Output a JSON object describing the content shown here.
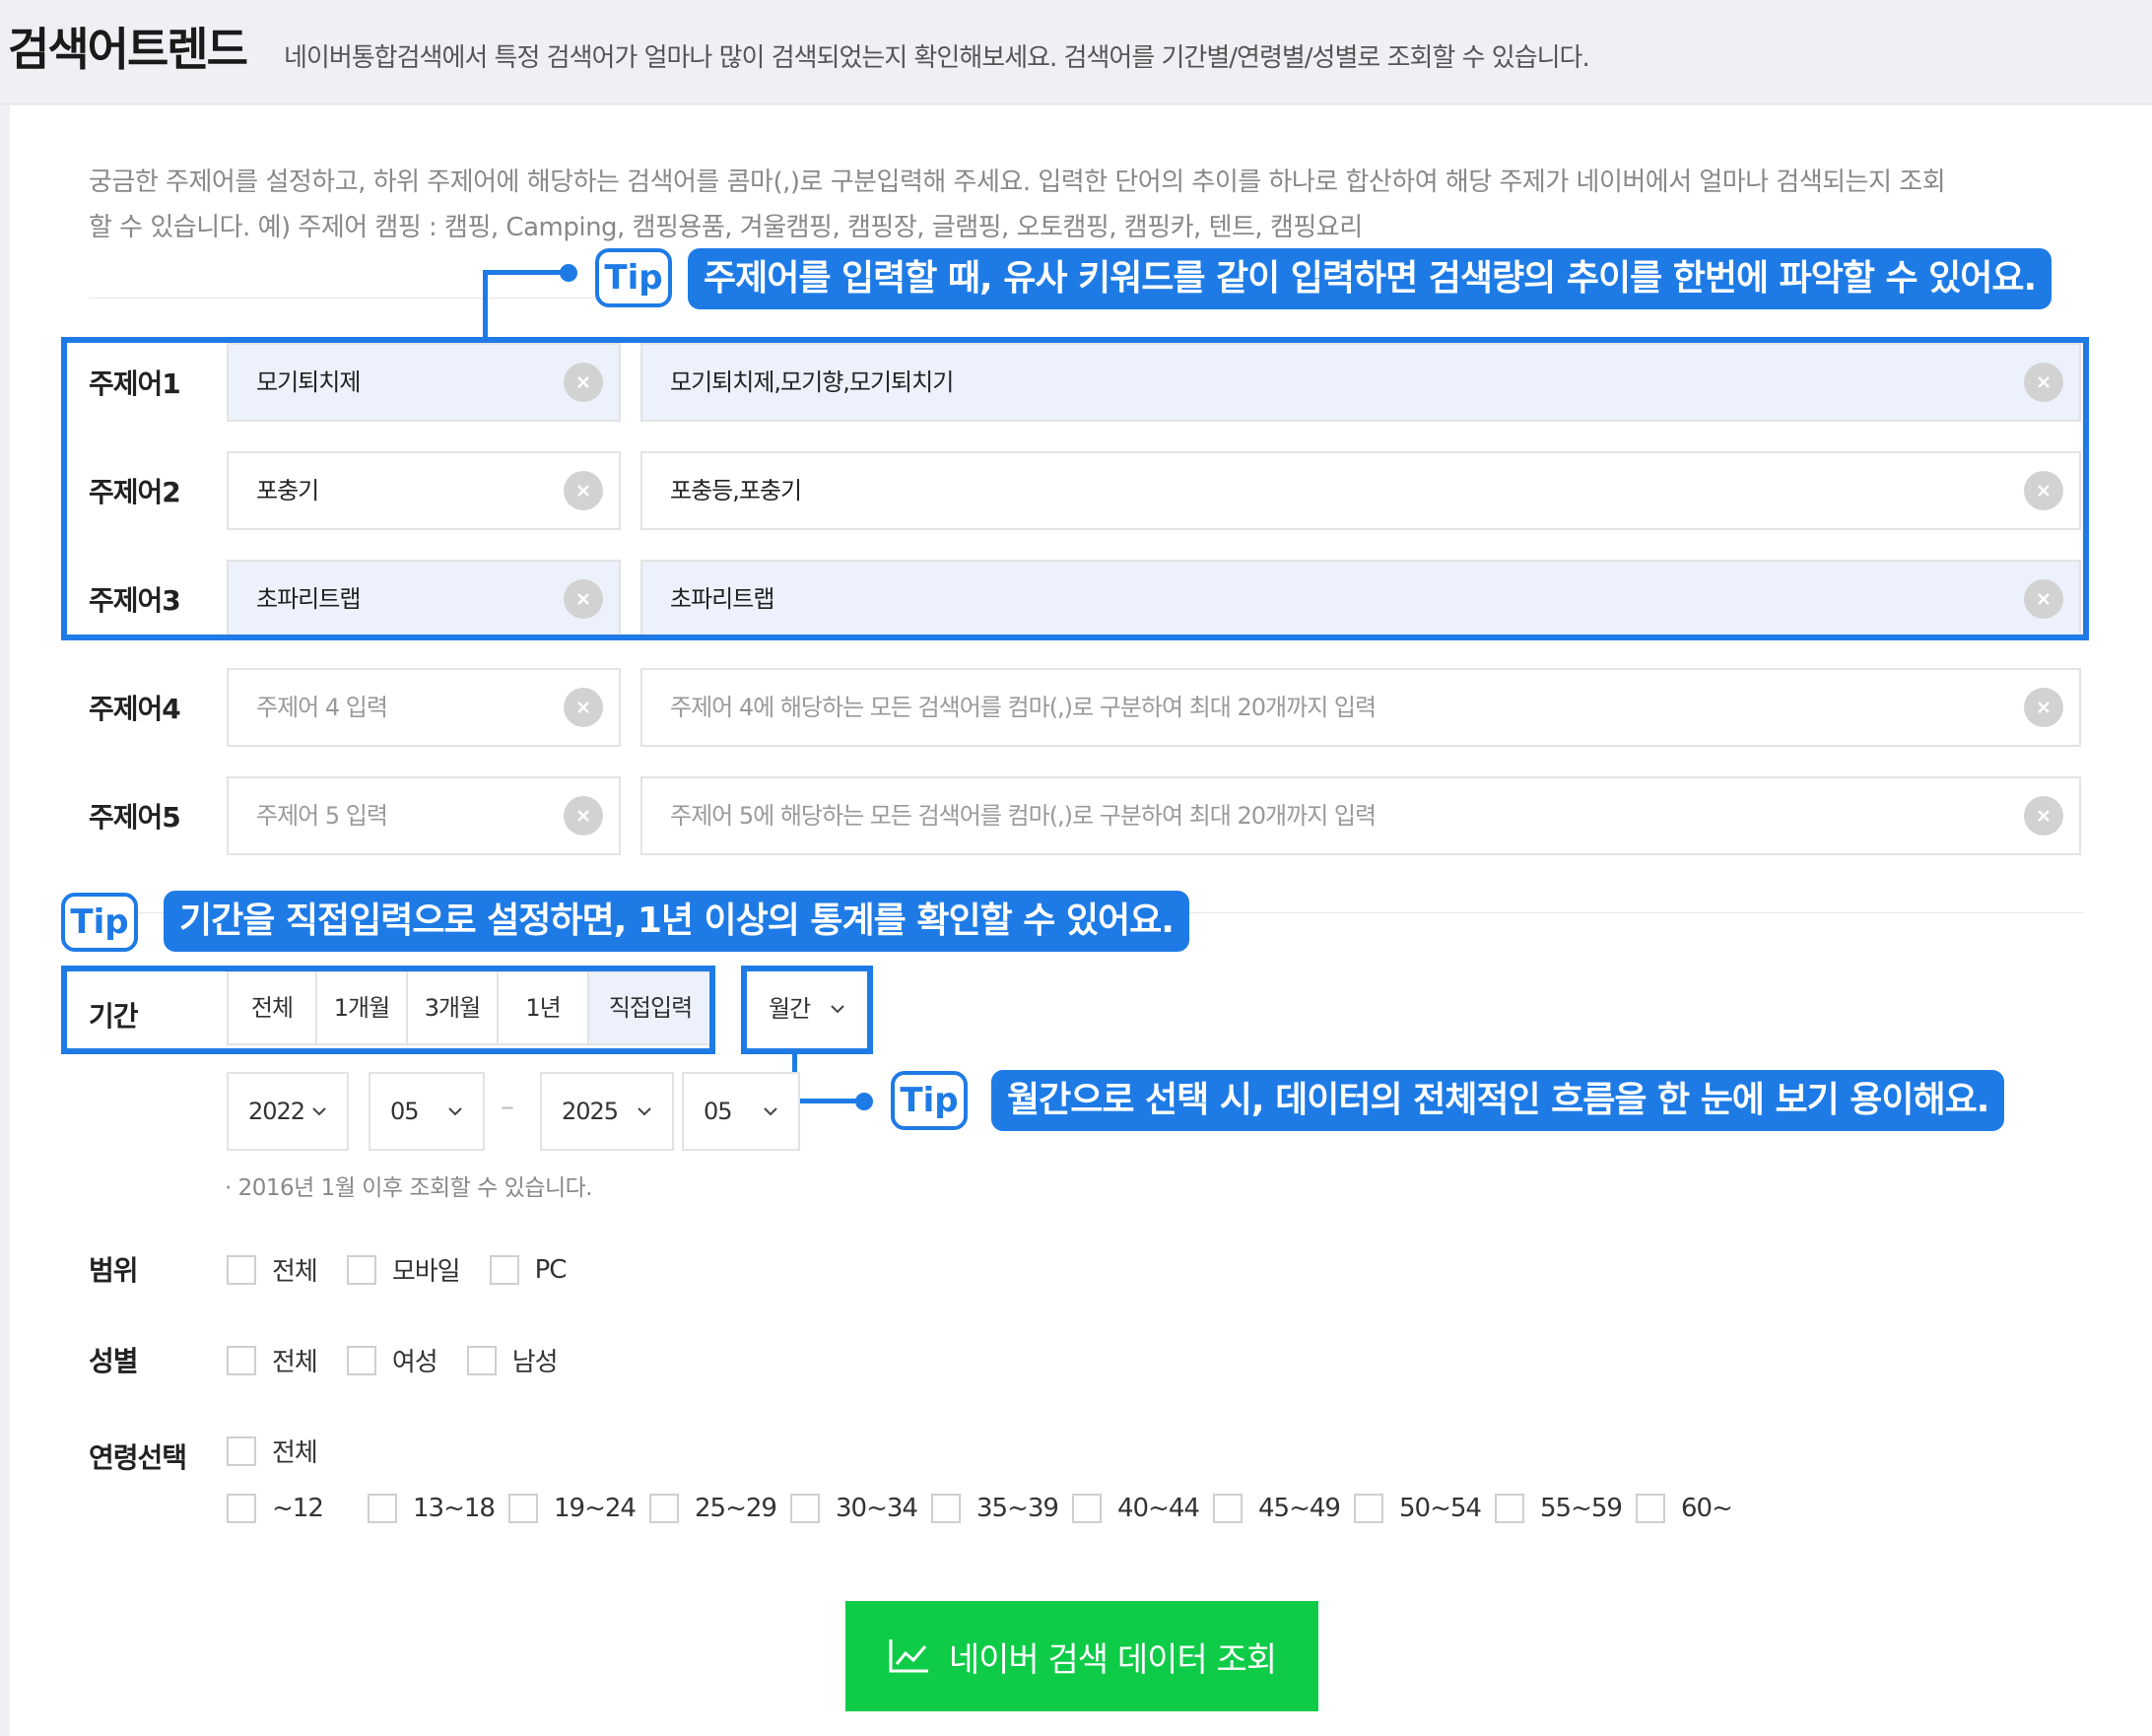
{
  "header": {
    "title": "검색어트렌드",
    "subtitle": "네이버통합검색에서 특정 검색어가 얼마나 많이 검색되었는지 확인해보세요. 검색어를 기간별/연령별/성별로 조회할 수 있습니다."
  },
  "intro": {
    "line1": "궁금한 주제어를 설정하고, 하위 주제어에 해당하는 검색어를 콤마(,)로 구분입력해 주세요. 입력한 단어의 추이를 하나로 합산하여 해당 주제가 네이버에서 얼마나 검색되는지 조회",
    "line2": "할 수 있습니다. 예) 주제어 캠핑 : 캠핑, Camping, 캠핑용품, 겨울캠핑, 캠핑장, 글램핑, 오토캠핑, 캠핑카, 텐트, 캠핑요리"
  },
  "tips": {
    "badge": "Tip",
    "tip1": "주제어를 입력할 때, 유사 키워드를 같이 입력하면 검색량의 추이를 한번에 파악할 수 있어요.",
    "tip2": "기간을 직접입력으로 설정하면, 1년 이상의 통계를 확인할 수 있어요.",
    "tip3": "월간으로 선택 시, 데이터의 전체적인 흐름을 한 눈에 보기 용이해요."
  },
  "topics": [
    {
      "label": "주제어1",
      "topic": "모기퇴치제",
      "keywords": "모기퇴치제,모기향,모기퇴치기",
      "topic_placeholder": "",
      "keywords_placeholder": ""
    },
    {
      "label": "주제어2",
      "topic": "포충기",
      "keywords": "포충등,포충기",
      "topic_placeholder": "",
      "keywords_placeholder": ""
    },
    {
      "label": "주제어3",
      "topic": "초파리트랩",
      "keywords": "초파리트랩",
      "topic_placeholder": "",
      "keywords_placeholder": ""
    },
    {
      "label": "주제어4",
      "topic": "",
      "keywords": "",
      "topic_placeholder": "주제어 4 입력",
      "keywords_placeholder": "주제어 4에 해당하는 모든 검색어를 컴마(,)로 구분하여 최대 20개까지 입력"
    },
    {
      "label": "주제어5",
      "topic": "",
      "keywords": "",
      "topic_placeholder": "주제어 5 입력",
      "keywords_placeholder": "주제어 5에 해당하는 모든 검색어를 컴마(,)로 구분하여 최대 20개까지 입력"
    }
  ],
  "period": {
    "label": "기간",
    "buttons": [
      "전체",
      "1개월",
      "3개월",
      "1년",
      "직접입력"
    ],
    "active": "직접입력",
    "interval": "월간",
    "start_year": "2022",
    "start_month": "05",
    "end_year": "2025",
    "end_month": "05",
    "separator": "–",
    "note": "· 2016년 1월 이후 조회할 수 있습니다."
  },
  "scope": {
    "label": "범위",
    "options": [
      "전체",
      "모바일",
      "PC"
    ]
  },
  "gender": {
    "label": "성별",
    "options": [
      "전체",
      "여성",
      "남성"
    ]
  },
  "age": {
    "label": "연령선택",
    "all": "전체",
    "options": [
      "~12",
      "13~18",
      "19~24",
      "25~29",
      "30~34",
      "35~39",
      "40~44",
      "45~49",
      "50~54",
      "55~59",
      "60~"
    ]
  },
  "submit": {
    "label": "네이버 검색 데이터 조회",
    "icon": "chart-line-icon"
  },
  "colors": {
    "accent": "#1e7be6",
    "submit": "#0ecc47",
    "highlight_bg": "#ecf1fb"
  }
}
